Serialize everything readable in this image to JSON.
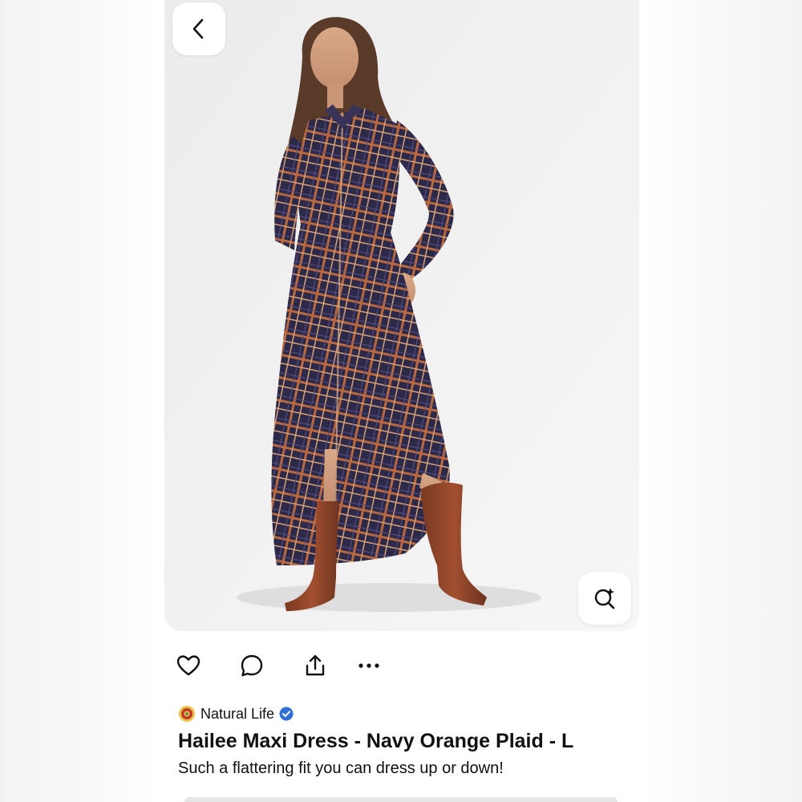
{
  "nav": {
    "back_icon": "chevron-left-icon"
  },
  "pin": {
    "image_subject": "photo",
    "visual_search_icon": "lens-sparkle-icon"
  },
  "actions": [
    {
      "name": "like",
      "icon": "heart-icon"
    },
    {
      "name": "comment",
      "icon": "comment-bubble-icon"
    },
    {
      "name": "share",
      "icon": "share-icon"
    },
    {
      "name": "more",
      "icon": "more-dots-icon"
    }
  ],
  "creator": {
    "name": "Natural Life",
    "verified": true,
    "accent_color": "#2f6fd6"
  },
  "title": "Hailee Maxi Dress - Navy Orange Plaid - L",
  "description": "Such a flattering fit you can dress up or down!",
  "colors": {
    "background": "#ffffff",
    "text": "#111111",
    "verified": "#2f6fd6"
  }
}
